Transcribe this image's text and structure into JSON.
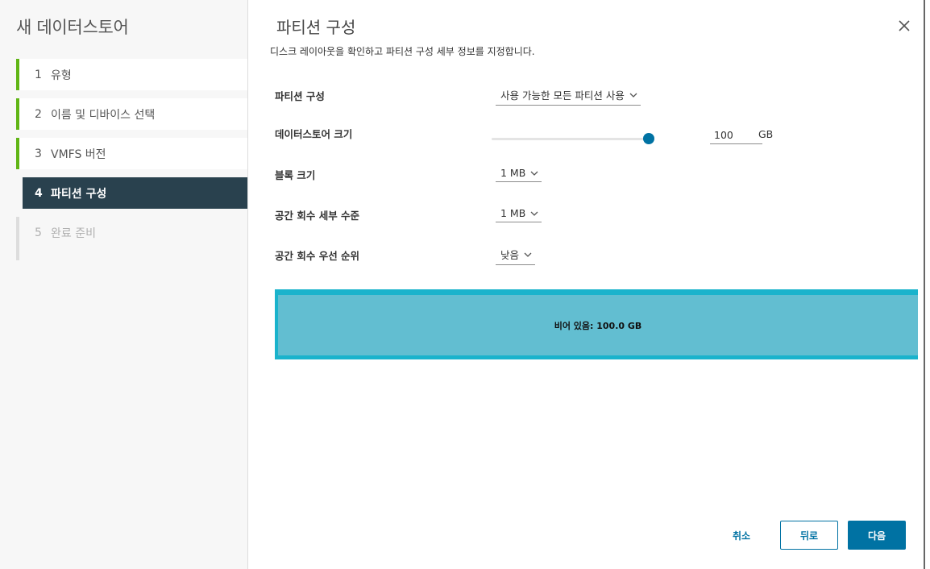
{
  "wizard": {
    "title": "새 데이터스토어",
    "steps": [
      {
        "num": "1",
        "label": "유형",
        "state": "done"
      },
      {
        "num": "2",
        "label": "이름 및 디바이스 선택",
        "state": "done"
      },
      {
        "num": "3",
        "label": "VMFS 버전",
        "state": "done"
      },
      {
        "num": "4",
        "label": "파티션 구성",
        "state": "active"
      },
      {
        "num": "5",
        "label": "완료 준비",
        "state": "future"
      }
    ]
  },
  "page": {
    "title": "파티션 구성",
    "subtitle": "디스크 레이아웃을 확인하고 파티션 구성 세부 정보를 지정합니다."
  },
  "form": {
    "partition_config": {
      "label": "파티션 구성",
      "value": "사용 가능한 모든 파티션 사용"
    },
    "datastore_size": {
      "label": "데이터스토어 크기",
      "value": "100",
      "unit": "GB",
      "slider_fraction": 1.0
    },
    "block_size": {
      "label": "블록 크기",
      "value": "1 MB"
    },
    "reclaim_granularity": {
      "label": "공간 회수 세부 수준",
      "value": "1 MB"
    },
    "reclaim_priority": {
      "label": "공간 회수 우선 순위",
      "value": "낮음"
    }
  },
  "partition_layout": {
    "label": "비어 있음: 100.0 GB"
  },
  "footer": {
    "cancel": "취소",
    "back": "뒤로",
    "next": "다음"
  },
  "colors": {
    "accent": "#0072a3",
    "done": "#60b515",
    "active_step": "#29414e",
    "partition": "#62bed1"
  }
}
